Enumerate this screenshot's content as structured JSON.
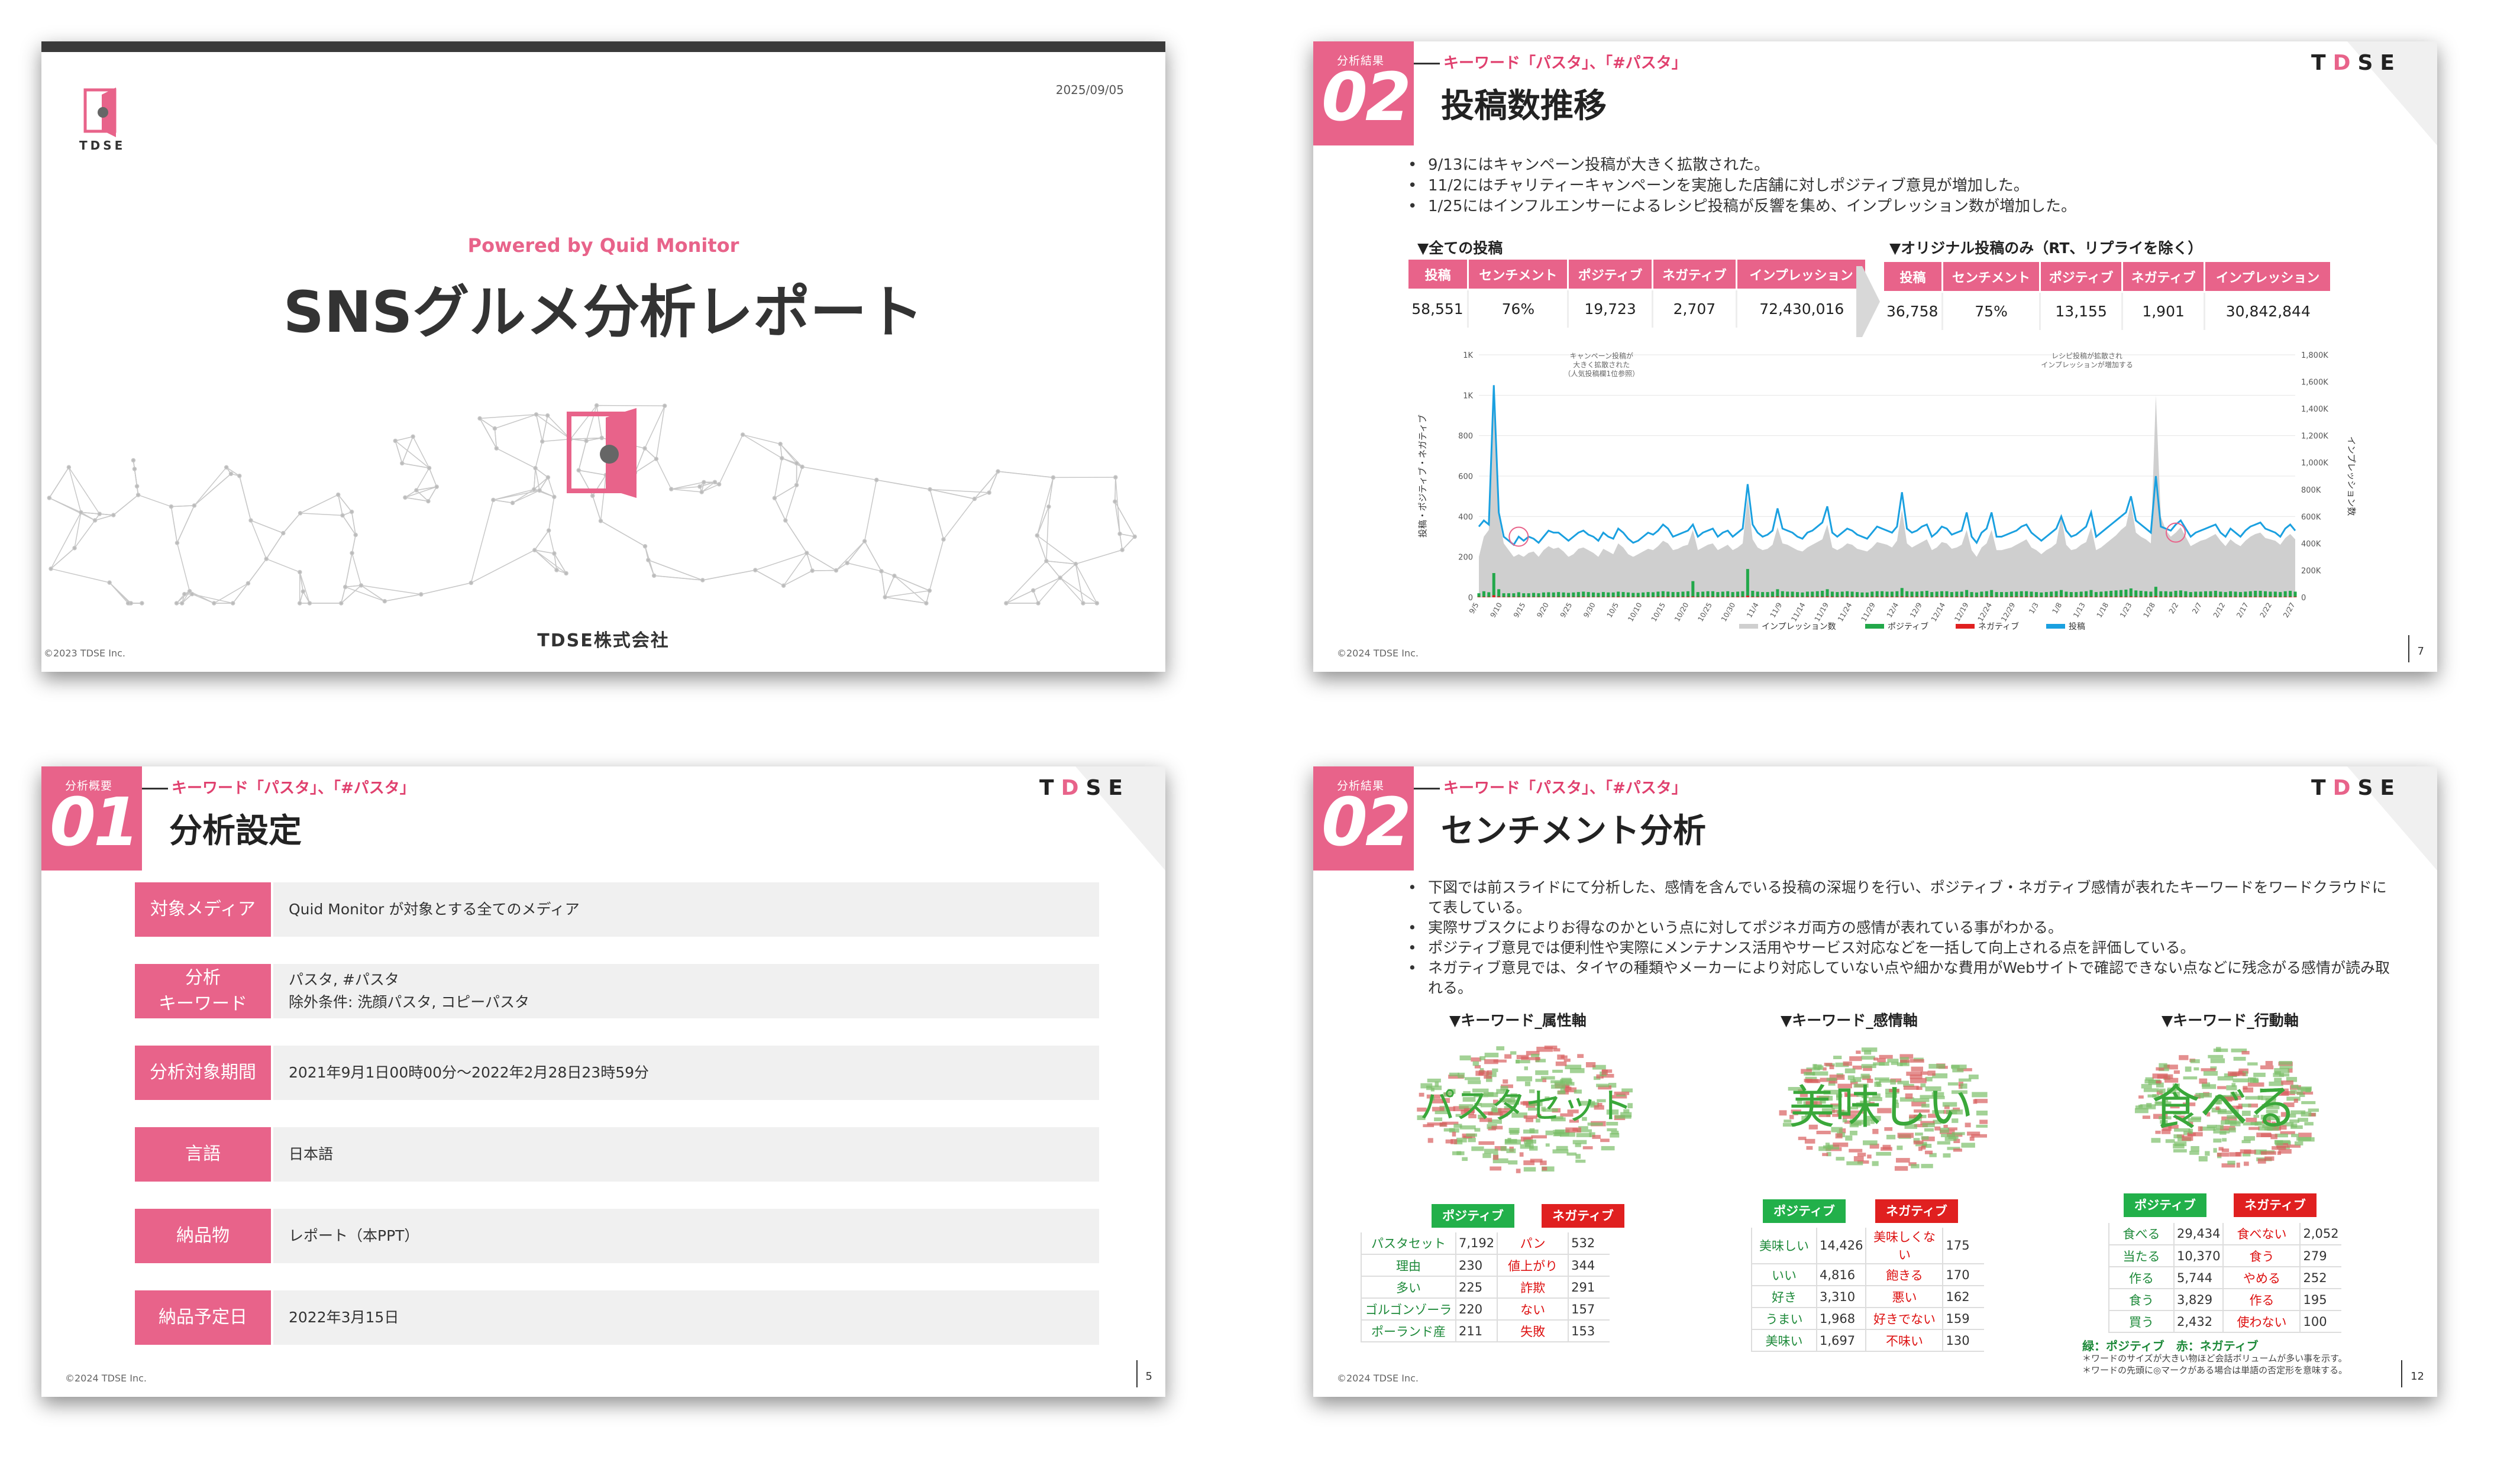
{
  "slide1": {
    "date": "2025/09/05",
    "logo_text": "TDSE",
    "powered": "Powered by Quid Monitor",
    "title": "SNSグルメ分析レポート",
    "company": "TDSE株式会社",
    "copyright": "©2023 TDSE Inc."
  },
  "slide2": {
    "section_label": "分析結果",
    "section_num": "02",
    "keyword": "キーワード「パスタ」、「#パスタ」",
    "title": "投稿数推移",
    "brand": "TDSE",
    "bullets": [
      "9/13にはキャンペーン投稿が大きく拡散された。",
      "11/2にはチャリティーキャンペーンを実施した店舗に対しポジティブ意見が増加した。",
      "1/25にはインフルエンサーによるレシピ投稿が反響を集め、インプレッション数が増加した。"
    ],
    "table_all": {
      "label": "▼全ての投稿",
      "headers": [
        "投稿",
        "センチメント",
        "ポジティブ",
        "ネガティブ",
        "インプレッション"
      ],
      "values": [
        "58,551",
        "76%",
        "19,723",
        "2,707",
        "72,430,016"
      ]
    },
    "table_orig": {
      "label": "▼オリジナル投稿のみ（RT、リプライを除く）",
      "headers": [
        "投稿",
        "センチメント",
        "ポジティブ",
        "ネガティブ",
        "インプレッション"
      ],
      "values": [
        "36,758",
        "75%",
        "13,155",
        "1,901",
        "30,842,844"
      ]
    },
    "copyright": "©2024 TDSE Inc.",
    "page": "7"
  },
  "chart_data": {
    "type": "line",
    "title": "",
    "ylabel": "投稿・ポジティブ・ネガティブ",
    "y2label": "インプレッション数",
    "y_ticks": [
      "0",
      "200",
      "400",
      "600",
      "800",
      "1K",
      "1K"
    ],
    "y2_ticks": [
      "0",
      "200K",
      "400K",
      "600K",
      "800K",
      "1,000K",
      "1,200K",
      "1,400K",
      "1,600K",
      "1,800K"
    ],
    "ylim": [
      0,
      1200
    ],
    "y2lim": [
      0,
      1800000
    ],
    "x_ticks": [
      "9/5",
      "9/10",
      "9/15",
      "9/20",
      "9/25",
      "9/30",
      "10/5",
      "10/10",
      "10/15",
      "10/20",
      "10/25",
      "10/30",
      "11/4",
      "11/9",
      "11/14",
      "11/19",
      "11/24",
      "11/29",
      "12/4",
      "12/9",
      "12/14",
      "12/19",
      "12/24",
      "12/29",
      "1/3",
      "1/8",
      "1/13",
      "1/18",
      "1/23",
      "1/28",
      "2/2",
      "2/7",
      "2/12",
      "2/17",
      "2/22",
      "2/27"
    ],
    "annotations": [
      {
        "text": "キャンペーン投稿が\n大きく拡散された\n（人気投稿欄1位参照）",
        "x_index": 8
      },
      {
        "text": "レシピ投稿が拡散され\nインプレッションが増加する",
        "x_index": 140
      }
    ],
    "legend": [
      "インプレッション数",
      "ポジティブ",
      "ネガティブ",
      "投稿"
    ],
    "grid": true,
    "series": [
      {
        "name": "投稿",
        "values": [
          350,
          380,
          360,
          1050,
          420,
          300,
          280,
          260,
          300,
          280,
          300,
          290,
          270,
          300,
          330,
          320,
          320,
          300,
          280,
          300,
          320,
          330,
          310,
          300,
          280,
          320,
          300,
          290,
          340,
          320,
          290,
          270,
          280,
          300,
          320,
          310,
          330,
          360,
          340,
          300,
          310,
          320,
          330,
          360,
          300,
          320,
          330,
          340,
          300,
          320,
          330,
          300,
          320,
          340,
          560,
          360,
          320,
          300,
          310,
          330,
          440,
          340,
          330,
          320,
          300,
          290,
          320,
          330,
          350,
          370,
          450,
          320,
          300,
          320,
          340,
          330,
          310,
          300,
          290,
          320,
          350,
          340,
          330,
          320,
          350,
          520,
          340,
          320,
          330,
          350,
          360,
          300,
          320,
          350,
          340,
          310,
          320,
          330,
          420,
          300,
          270,
          320,
          340,
          420,
          300,
          300,
          310,
          320,
          330,
          350,
          360,
          320,
          300,
          280,
          300,
          320,
          340,
          400,
          330,
          300,
          310,
          330,
          350,
          420,
          300,
          320,
          340,
          360,
          380,
          400,
          420,
          500,
          380,
          360,
          340,
          320,
          600,
          350,
          340,
          330,
          360,
          380,
          340,
          300,
          320,
          330,
          340,
          350,
          360,
          320,
          300,
          340,
          320,
          300,
          330,
          350,
          360,
          370,
          340,
          330,
          320,
          300,
          340,
          360,
          330
        ]
      },
      {
        "name": "ポジティブ",
        "values": [
          20,
          30,
          25,
          120,
          40,
          20,
          20,
          20,
          25,
          20,
          20,
          22,
          20,
          24,
          25,
          24,
          26,
          24,
          22,
          24,
          26,
          28,
          26,
          24,
          22,
          26,
          24,
          24,
          28,
          26,
          24,
          22,
          22,
          24,
          26,
          25,
          28,
          30,
          28,
          26,
          26,
          28,
          30,
          80,
          26,
          28,
          30,
          30,
          26,
          28,
          30,
          26,
          28,
          30,
          140,
          32,
          28,
          26,
          26,
          28,
          40,
          30,
          28,
          28,
          26,
          24,
          28,
          28,
          30,
          32,
          40,
          28,
          26,
          28,
          30,
          28,
          26,
          24,
          24,
          28,
          30,
          30,
          28,
          28,
          30,
          46,
          30,
          28,
          28,
          30,
          32,
          26,
          28,
          30,
          30,
          26,
          28,
          28,
          36,
          26,
          24,
          28,
          30,
          36,
          26,
          26,
          26,
          28,
          28,
          30,
          30,
          28,
          26,
          24,
          26,
          28,
          30,
          36,
          28,
          26,
          26,
          28,
          30,
          36,
          26,
          28,
          30,
          32,
          34,
          36,
          38,
          44,
          34,
          32,
          30,
          28,
          52,
          30,
          30,
          28,
          32,
          34,
          30,
          26,
          28,
          28,
          30,
          30,
          32,
          28,
          26,
          30,
          28,
          26,
          28,
          30,
          32,
          32,
          30,
          28,
          28,
          26,
          30,
          32,
          28
        ]
      },
      {
        "name": "ネガティブ",
        "values": [
          2,
          3,
          2,
          10,
          4,
          2,
          2,
          2,
          2,
          2,
          2,
          2,
          2,
          2,
          2,
          2,
          2,
          2,
          2,
          2,
          2,
          3,
          2,
          2,
          2,
          2,
          2,
          2,
          3,
          2,
          2,
          2,
          2,
          2,
          2,
          2,
          3,
          3,
          3,
          2,
          2,
          3,
          3,
          4,
          2,
          3,
          3,
          3,
          2,
          3,
          3,
          2,
          3,
          3,
          8,
          3,
          3,
          2,
          2,
          3,
          4,
          3,
          3,
          3,
          2,
          2,
          3,
          3,
          3,
          3,
          4,
          3,
          2,
          3,
          3,
          3,
          2,
          2,
          2,
          3,
          3,
          3,
          3,
          3,
          3,
          4,
          3,
          3,
          3,
          3,
          3,
          2,
          3,
          3,
          3,
          2,
          3,
          3,
          3,
          2,
          2,
          3,
          3,
          3,
          2,
          2,
          2,
          3,
          3,
          3,
          3,
          3,
          2,
          2,
          2,
          3,
          3,
          3,
          3,
          2,
          2,
          3,
          3,
          3,
          2,
          3,
          3,
          3,
          3,
          3,
          3,
          4,
          3,
          3,
          3,
          3,
          5,
          3,
          3,
          3,
          3,
          3,
          3,
          2,
          3,
          3,
          3,
          3,
          3,
          3,
          2,
          3,
          3,
          2,
          3,
          3,
          3,
          3,
          3,
          3,
          3,
          2,
          3,
          3,
          3
        ]
      },
      {
        "name": "インプレッション数",
        "values": [
          300000,
          450000,
          500000,
          1500000,
          600000,
          400000,
          350000,
          300000,
          320000,
          300000,
          330000,
          340000,
          300000,
          350000,
          380000,
          360000,
          370000,
          340000,
          300000,
          320000,
          360000,
          370000,
          350000,
          330000,
          300000,
          360000,
          340000,
          320000,
          400000,
          370000,
          320000,
          300000,
          320000,
          340000,
          360000,
          350000,
          380000,
          420000,
          400000,
          350000,
          360000,
          380000,
          390000,
          500000,
          350000,
          370000,
          390000,
          400000,
          350000,
          370000,
          390000,
          350000,
          370000,
          400000,
          750000,
          430000,
          370000,
          350000,
          360000,
          390000,
          520000,
          400000,
          390000,
          370000,
          350000,
          340000,
          370000,
          390000,
          410000,
          430000,
          540000,
          370000,
          350000,
          370000,
          400000,
          390000,
          360000,
          350000,
          340000,
          370000,
          410000,
          400000,
          390000,
          370000,
          420000,
          650000,
          400000,
          370000,
          390000,
          410000,
          430000,
          350000,
          370000,
          410000,
          400000,
          360000,
          370000,
          390000,
          500000,
          350000,
          300000,
          370000,
          400000,
          500000,
          350000,
          350000,
          360000,
          370000,
          390000,
          410000,
          430000,
          370000,
          350000,
          320000,
          350000,
          370000,
          400000,
          600000,
          390000,
          350000,
          360000,
          390000,
          410000,
          520000,
          350000,
          370000,
          400000,
          430000,
          460000,
          500000,
          530000,
          700000,
          480000,
          450000,
          430000,
          400000,
          1500000,
          600000,
          500000,
          450000,
          480000,
          520000,
          450000,
          380000,
          400000,
          420000,
          430000,
          450000,
          470000,
          420000,
          380000,
          430000,
          400000,
          380000,
          420000,
          450000,
          470000,
          480000,
          440000,
          430000,
          420000,
          390000,
          440000,
          470000,
          430000
        ]
      }
    ]
  },
  "slide3": {
    "section_label": "分析概要",
    "section_num": "01",
    "keyword": "キーワード「パスタ」、「#パスタ」",
    "title": "分析設定",
    "brand": "TDSE",
    "rows": [
      {
        "key": "対象メディア",
        "val1": "Quid Monitor が対象とする全てのメディア",
        "val2": ""
      },
      {
        "key": "分析\nキーワード",
        "val1": "パスタ, #パスタ",
        "val2": "除外条件: 洗顔パスタ, コピーパスタ"
      },
      {
        "key": "分析対象期間",
        "val1": "2021年9月1日00時00分～2022年2月28日23時59分",
        "val2": ""
      },
      {
        "key": "言語",
        "val1": "日本語",
        "val2": ""
      },
      {
        "key": "納品物",
        "val1": "レポート（本PPT）",
        "val2": ""
      },
      {
        "key": "納品予定日",
        "val1": "2022年3月15日",
        "val2": ""
      }
    ],
    "copyright": "©2024 TDSE Inc.",
    "page": "5"
  },
  "slide4": {
    "section_label": "分析結果",
    "section_num": "02",
    "keyword": "キーワード「パスタ」、「#パスタ」",
    "title": "センチメント分析",
    "brand": "TDSE",
    "bullets": [
      "下図では前スライドにて分析した、感情を含んでいる投稿の深堀りを行い、ポジティブ・ネガティブ感情が表れたキーワードをワードクラウドにて表している。",
      "実際サブスクによりお得なのかという点に対してポジネガ両方の感情が表れている事がわかる。",
      "ポジティブ意見では便利性や実際にメンテナンス活用やサービス対応などを一括して向上される点を評価している。",
      "ネガティブ意見では、タイヤの種類やメーカーにより対応していない点や細かな費用がWebサイトで確認できない点などに残念がる感情が読み取れる。"
    ],
    "clouds": [
      {
        "head": "▼キーワード_属性軸",
        "big": "パスタセット",
        "pos_label": "ポジティブ",
        "neg_label": "ネガティブ",
        "rows": [
          [
            "パスタセット",
            "7,192",
            "パン",
            "532"
          ],
          [
            "理由",
            "230",
            "値上がり",
            "344"
          ],
          [
            "多い",
            "225",
            "詐欺",
            "291"
          ],
          [
            "ゴルゴンゾーラ",
            "220",
            "ない",
            "157"
          ],
          [
            "ポーランド産",
            "211",
            "失敗",
            "153"
          ]
        ]
      },
      {
        "head": "▼キーワード_感情軸",
        "big": "美味しい",
        "pos_label": "ポジティブ",
        "neg_label": "ネガティブ",
        "rows": [
          [
            "美味しい",
            "14,426",
            "美味しくない",
            "175"
          ],
          [
            "いい",
            "4,816",
            "飽きる",
            "170"
          ],
          [
            "好き",
            "3,310",
            "悪い",
            "162"
          ],
          [
            "うまい",
            "1,968",
            "好きでない",
            "159"
          ],
          [
            "美味い",
            "1,697",
            "不味い",
            "130"
          ]
        ]
      },
      {
        "head": "▼キーワード_行動軸",
        "big": "食べる",
        "pos_label": "ポジティブ",
        "neg_label": "ネガティブ",
        "rows": [
          [
            "食べる",
            "29,434",
            "食べない",
            "2,052"
          ],
          [
            "当たる",
            "10,370",
            "食う",
            "279"
          ],
          [
            "作る",
            "5,744",
            "やめる",
            "252"
          ],
          [
            "食う",
            "3,829",
            "作る",
            "195"
          ],
          [
            "買う",
            "2,432",
            "使わない",
            "100"
          ]
        ]
      }
    ],
    "note_title": "緑：ポジティブ　赤：ネガティブ",
    "notes": [
      "＊ワードのサイズが大きい物ほど会話ボリュームが多い事を示す。",
      "＊ワードの先頭に◎マークがある場合は単語の否定形を意味する。"
    ],
    "copyright": "©2024 TDSE Inc.",
    "page": "12"
  }
}
